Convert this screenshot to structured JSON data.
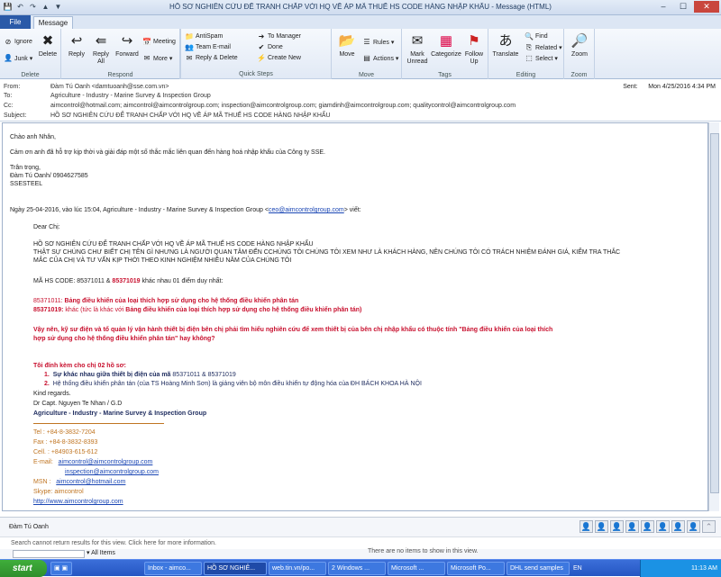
{
  "window": {
    "title": "HỒ SƠ NGHIÊN CỨU ĐỂ TRANH CHẤP VỚI HQ VỀ ÁP MÃ THUẾ HS CODE HÀNG NHẬP KHẨU - Message (HTML)",
    "min": "–",
    "max": "☐",
    "close": "✕"
  },
  "tabs": {
    "file": "File",
    "message": "Message"
  },
  "ribbon": {
    "ignore": "Ignore",
    "junk": "Junk ▾",
    "delete": "Delete",
    "g_delete": "Delete",
    "reply": "Reply",
    "reply_all": "Reply All",
    "forward": "Forward",
    "meeting": "Meeting",
    "more": "More ▾",
    "g_respond": "Respond",
    "qs_antispam": "AntiSpam",
    "qs_team": "Team E-mail",
    "qs_replydel": "Reply & Delete",
    "qs_tomanager": "To Manager",
    "qs_done": "Done",
    "qs_createnew": "Create New",
    "g_quicksteps": "Quick Steps",
    "move": "Move",
    "rules": "Rules ▾",
    "actions": "Actions ▾",
    "g_move": "Move",
    "mark_unread": "Mark Unread",
    "categorize": "Categorize",
    "follow_up": "Follow Up",
    "g_tags": "Tags",
    "translate": "Translate",
    "find": "Find",
    "related": "Related ▾",
    "select": "Select ▾",
    "g_editing": "Editing",
    "zoom": "Zoom",
    "g_zoom": "Zoom"
  },
  "header": {
    "from_label": "From:",
    "from": "Đàm Tú Oanh <damtuoanh@sse.com.vn>",
    "to_label": "To:",
    "to": "Agriculture - Industry - Marine Survey & Inspection Group",
    "cc_label": "Cc:",
    "cc": "aimcontrol@hotmail.com;   aimcontrol@aimcontrolgroup.com;   inspection@aimcontrolgroup.com;   giamdinh@aimcontrolgroup.com;   qualitycontrol@aimcontrolgroup.com",
    "subject_label": "Subject:",
    "subject": "HỒ SƠ NGHIÊN CỨU ĐỂ TRANH CHẤP VỚI HQ VỀ ÁP MÃ THUẾ HS CODE HÀNG NHẬP KHẨU",
    "sent_label": "Sent:",
    "sent": "Mon 4/25/2016 4:34 PM"
  },
  "body": {
    "l1": "Chào anh Nhân,",
    "l2": "Cảm ơn anh đã hỗ trợ kịp thời và giải đáp một số thắc mắc liên quan đến hàng hoá nhập khẩu của Công ty SSE.",
    "l3": "Trân trọng,",
    "l4": "Đàm Tú Oanh/ 0904627585",
    "l5": "SSESTEEL",
    "q_pre": "Ngày 25-04-2016, vào lúc 15:04, Agriculture - Industry - Marine Survey & Inspection Group <",
    "q_email": "ceo@aimcontrolgroup.com",
    "q_post": "> viết:",
    "dear": "Dear Chị:",
    "p1": "HỒ SƠ NGHIÊN CỨU ĐỂ TRANH CHẤP VỚI HQ VỀ ÁP MÃ THUẾ HS CODE HÀNG NHẬP KHẨU",
    "p2": "THẬT SỰ CHÚNG CHƯ BIẾT CHỊ TÊN GÌ NHƯNG LÀ NGƯỜI QUAN TÂM ĐẾN CCHÚNG TÔI CHÚNG TÔI XEM NHƯ LÀ KHÁCH HÀNG, NÊN CHÚNG TÔI CÓ TRÁCH NHIỆM ĐÁNH GIÁ, KIỂM TRA THẮC",
    "p3": "MẮC CỦA CHỊ VÀ TƯ VẤN KỊP THỜI THEO KINH NGHIỆM NHIỀU NĂM CỦA CHÚNG TÔI",
    "hs_pre": "MÃ HS CODE: 85371011 & ",
    "hs_red": "85371019",
    "hs_post": " khác nhau 01 điểm duy nhất:",
    "c1_code": "85371011: ",
    "c1_text": "Bảng điều khiển của loại thích hợp sử dụng cho hệ thống điều khiển phân tán",
    "c2_code": "85371019: ",
    "c2_plain": "khác (tức là khác với ",
    "c2_red": "Bảng điều khiển của loại thích hợp sử dụng cho hệ thống điều khiển phân tán)",
    "q1": "Vậy nên, kỹ sư điện và tổ quản lý vận hành thiết bị điện bên chị phải tìm hiểu nghiên cứu để xem thiết bị của bên chị nhập khẩu có thuộc tính \"Bảng điều khiển của loại thích",
    "q2": "hợp sử dụng cho hệ thống điều khiển phân tán\" hay không?",
    "att": "Tôi đính kèm cho chị 02 hồ sơ:",
    "li1_n": "1.",
    "li1_b": "Sự khác nhau giữa thiết bị điện của mã ",
    "li1_t": "85371011 & 85371019",
    "li2_n": "2.",
    "li2_t": "Hệ thống điều khiển phân tán (của TS Hoàng Minh Sơn) là giảng viên bộ môn điều khiển tự động hóa của ĐH BÁCH KHOA HÀ NỘI",
    "kind": "Kind regards.",
    "sig_name": "Dr Capt. Nguyen Te Nhan / G.D",
    "sig_org": "Agriculture - Industry - Marine Survey & Inspection Group",
    "tel": "Tel      :  +84-8-3832-7204",
    "fax": "Fax     :  +84-8-3832-8393",
    "cell": "Cell.    :  +84903-615-612",
    "email_lbl": "E-mail: ",
    "email1": "aimcontrol@aimcontrolgroup.com",
    "email2": "inspection@aimcontrolgroup.com",
    "msn_lbl": "MSN  : ",
    "msn": "aimcontrol@hotmail.com",
    "skype": "Skype:  aimcontrol",
    "web": "http://www.aimcontrolgroup.com"
  },
  "people": {
    "name": "Đàm Tú Oanh",
    "search_msg": "Search cannot return results for this view. Click here for more information.",
    "no_items": "There are no items to show in this view.",
    "all_items": "All Items"
  },
  "taskbar": {
    "start": "start",
    "t1": "Inbox - aimco...",
    "t2": "HỒ SƠ NGHIÊ...",
    "t3": "web.tin.vn/po...",
    "t4": "2 Windows ...",
    "t5": "Microsoft ...",
    "t6": "Microsoft Po...",
    "t7": "DHL send samples",
    "lang": "EN",
    "time": "11:13 AM"
  }
}
